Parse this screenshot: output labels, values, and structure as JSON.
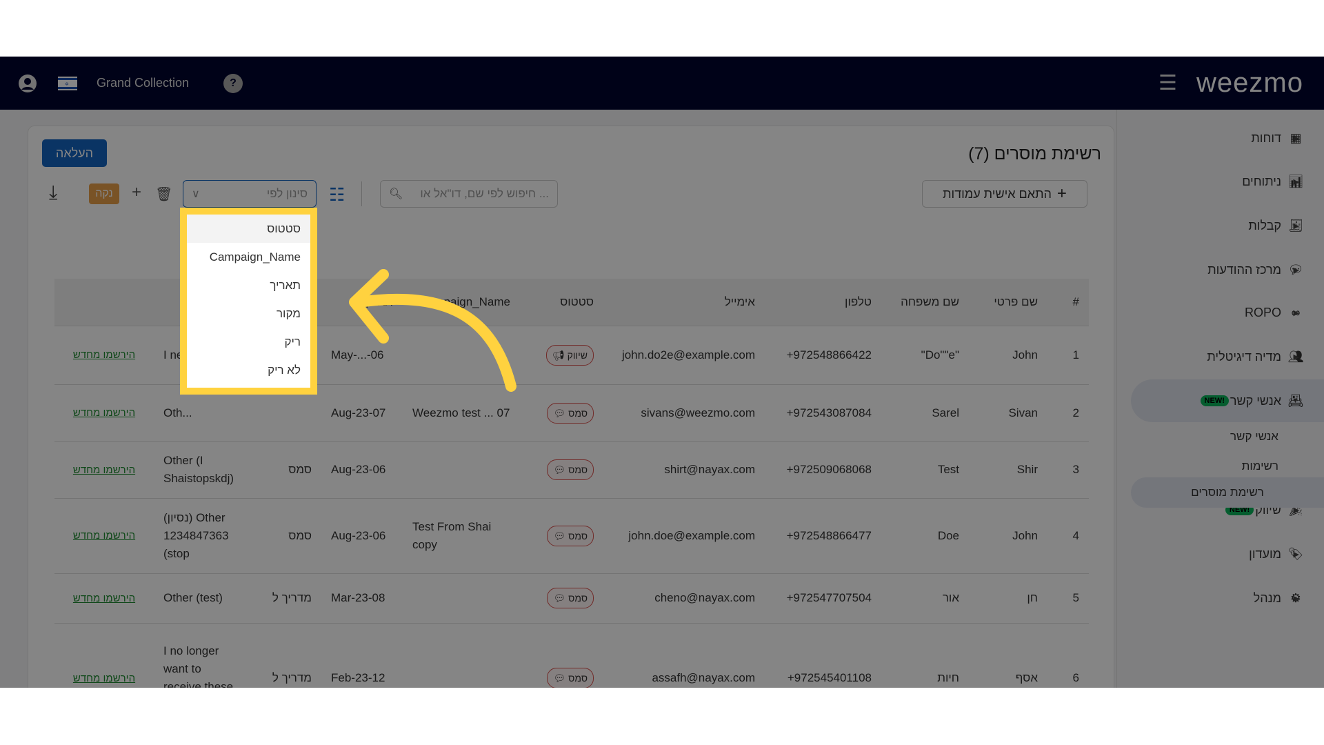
{
  "header": {
    "org": "Grand Collection",
    "brand": "weezmo"
  },
  "sidebar": {
    "items": [
      {
        "label": "דוחות",
        "icon": "dashboard-icon"
      },
      {
        "label": "ניתוחים",
        "icon": "analytics-icon"
      },
      {
        "label": "קבלות",
        "icon": "receipt-icon"
      },
      {
        "label": "מרכז ההודעות",
        "icon": "chat-icon"
      },
      {
        "label": "ROPO",
        "icon": "infinity-icon"
      },
      {
        "label": "מדיה דיגיטלית",
        "icon": "people-icon"
      },
      {
        "label": "אנשי קשר",
        "icon": "contact-card-icon",
        "badge": "NEW!",
        "expanded": true
      },
      {
        "label": "שיווק",
        "icon": "party-popper-icon",
        "badge": "NEW!"
      },
      {
        "label": "מועדון",
        "icon": "tag-icon"
      },
      {
        "label": "מנהל",
        "icon": "gear-icon"
      }
    ],
    "subitems": [
      "אנשי קשר",
      "רשימות",
      "רשימת מוסרים"
    ],
    "active": "רשימת מוסרים"
  },
  "page": {
    "title": "רשימת מוסרים (7)",
    "upload": "העלאה",
    "customize": "התאם אישית עמודות",
    "search_placeholder": "חיפוש לפי שם, דו\"אל או ...",
    "filter_placeholder": "סינון לפי",
    "clear": "נקה"
  },
  "filter_options": [
    "סטטוס",
    "Campaign_Name",
    "תאריך",
    "מקור",
    "ריק",
    "לא ריק"
  ],
  "table": {
    "headers": [
      "#",
      "שם פרטי",
      "שם משפחה",
      "טלפון",
      "אימייל",
      "סטטוס",
      "Campaign_Name",
      "תאריך",
      "",
      "",
      " "
    ],
    "rows": [
      {
        "n": "1",
        "first": "John",
        "last": "\"Do\"\"e\"",
        "phone": "972548866422+",
        "email": "john.do2e@example.com",
        "status": "שיווק",
        "status_icon": "megaphone-icon",
        "campaign": "",
        "date": "May-...-06",
        "source": "",
        "reason": "I ne... sig...",
        "link": "הירשמו מחדש"
      },
      {
        "n": "2",
        "first": "Sivan",
        "last": "Sarel",
        "phone": "972543087084+",
        "email": "sivans@weezmo.com",
        "status": "סמס",
        "status_icon": "chat-icon",
        "campaign": "Weezmo test ... 07",
        "date": "Aug-23-07",
        "source": "",
        "reason": "Oth...",
        "link": "הירשמו מחדש"
      },
      {
        "n": "3",
        "first": "Shir",
        "last": "Test",
        "phone": "972509068068+",
        "email": "shirt@nayax.com",
        "status": "סמס",
        "status_icon": "chat-icon",
        "campaign": "",
        "date": "Aug-23-06",
        "source": "סמס",
        "reason": "Other (I Shaistopskdj)",
        "link": "הירשמו מחדש"
      },
      {
        "n": "4",
        "first": "John",
        "last": "Doe",
        "phone": "972548866477+",
        "email": "john.doe@example.com",
        "status": "סמס",
        "status_icon": "chat-icon",
        "campaign": "Test From Shai copy",
        "date": "Aug-23-06",
        "source": "סמס",
        "reason": "(נסיון) Other 1234847363 (stop",
        "link": "הירשמו מחדש"
      },
      {
        "n": "5",
        "first": "חן",
        "last": "אור",
        "phone": "972547707504+",
        "email": "cheno@nayax.com",
        "status": "סמס",
        "status_icon": "chat-icon",
        "campaign": "",
        "date": "Mar-23-08",
        "source": "מדריך ל",
        "reason": "Other (test)",
        "link": "הירשמו מחדש"
      },
      {
        "n": "6",
        "first": "אסף",
        "last": "חיות",
        "phone": "972545401108+",
        "email": "assafh@nayax.com",
        "status": "סמס",
        "status_icon": "chat-icon",
        "campaign": "",
        "date": "Feb-23-12",
        "source": "מדריך ל",
        "reason": "I no longer want to receive these notifications",
        "link": "הירשמו מחדש"
      }
    ]
  },
  "colors": {
    "header": "#00052e",
    "highlight": "#ffd23f",
    "primary": "#1565c0",
    "new_badge": "#0bb25a",
    "link": "#1c8a2e"
  }
}
